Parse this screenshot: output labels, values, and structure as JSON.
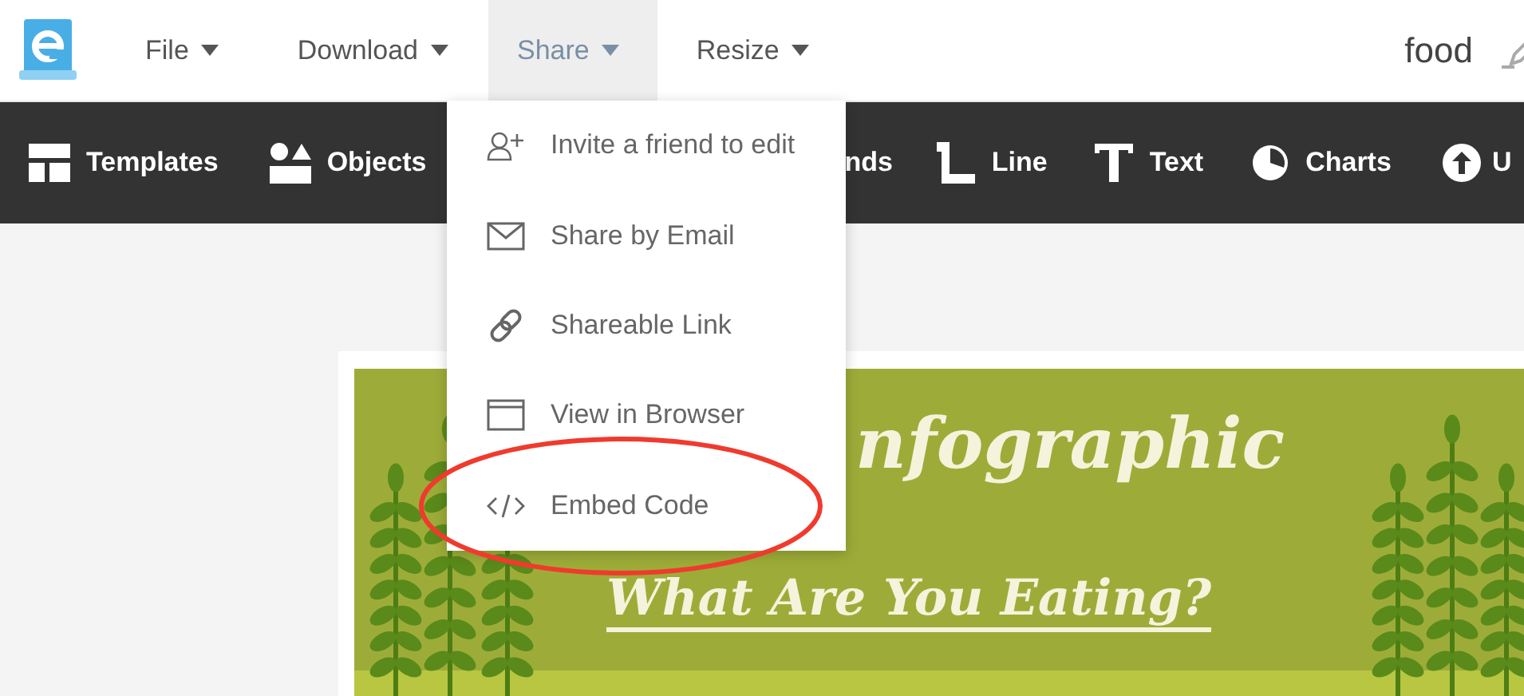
{
  "menu_bar": {
    "items": [
      {
        "label": "File",
        "selected": false
      },
      {
        "label": "Download",
        "selected": false
      },
      {
        "label": "Share",
        "selected": true
      },
      {
        "label": "Resize",
        "selected": false
      }
    ]
  },
  "document_title": "food",
  "toolbar": {
    "items": [
      {
        "label": "Templates",
        "kind": "templates"
      },
      {
        "label": "Objects",
        "kind": "objects"
      },
      {
        "label": "nds",
        "kind": "none"
      },
      {
        "label": "Line",
        "kind": "line"
      },
      {
        "label": "Text",
        "kind": "text"
      },
      {
        "label": "Charts",
        "kind": "charts"
      },
      {
        "label": "U",
        "kind": "upload"
      }
    ]
  },
  "share_menu": {
    "items": [
      {
        "label": "Invite a friend to edit",
        "kind": "invite"
      },
      {
        "label": "Share by Email",
        "kind": "email"
      },
      {
        "label": "Shareable Link",
        "kind": "link"
      },
      {
        "label": "View in Browser",
        "kind": "browser"
      },
      {
        "label": "Embed Code",
        "kind": "embed"
      }
    ]
  },
  "canvas": {
    "title": "nfographic",
    "subtitle": "What Are You Eating?"
  }
}
